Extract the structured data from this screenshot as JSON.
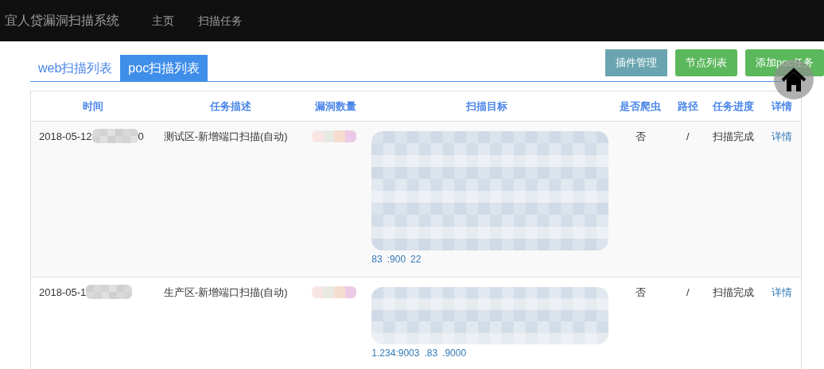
{
  "navbar": {
    "brand": "宜人贷漏洞扫描系统",
    "links": [
      "主页",
      "扫描任务"
    ]
  },
  "tabs": [
    {
      "label": "web扫描列表",
      "selected": false
    },
    {
      "label": "poc扫描列表",
      "selected": true
    }
  ],
  "actions": [
    {
      "label": "插件管理",
      "kind": "info"
    },
    {
      "label": "节点列表",
      "kind": "success"
    },
    {
      "label": "添加poc任务",
      "kind": "success"
    }
  ],
  "table": {
    "columns": [
      "时间",
      "任务描述",
      "漏洞数量",
      "扫描目标",
      "是否爬虫",
      "路径",
      "任务进度",
      "详情"
    ],
    "rows": [
      {
        "time_start": "2018-05-12",
        "time_end": "0",
        "description": "测试区-新增端口扫描(自动)",
        "target_fragments": [
          "83",
          ":900",
          "22"
        ],
        "crawler": "否",
        "path": "/",
        "progress": "扫描完成",
        "details": "详情"
      },
      {
        "time_start": "2018-05-1",
        "description": "生产区-新增端口扫描(自动)",
        "target_fragments": [
          "1.234:9003",
          ".83",
          ".9000"
        ],
        "crawler": "否",
        "path": "/",
        "progress": "扫描完成",
        "details": "详情"
      }
    ]
  }
}
